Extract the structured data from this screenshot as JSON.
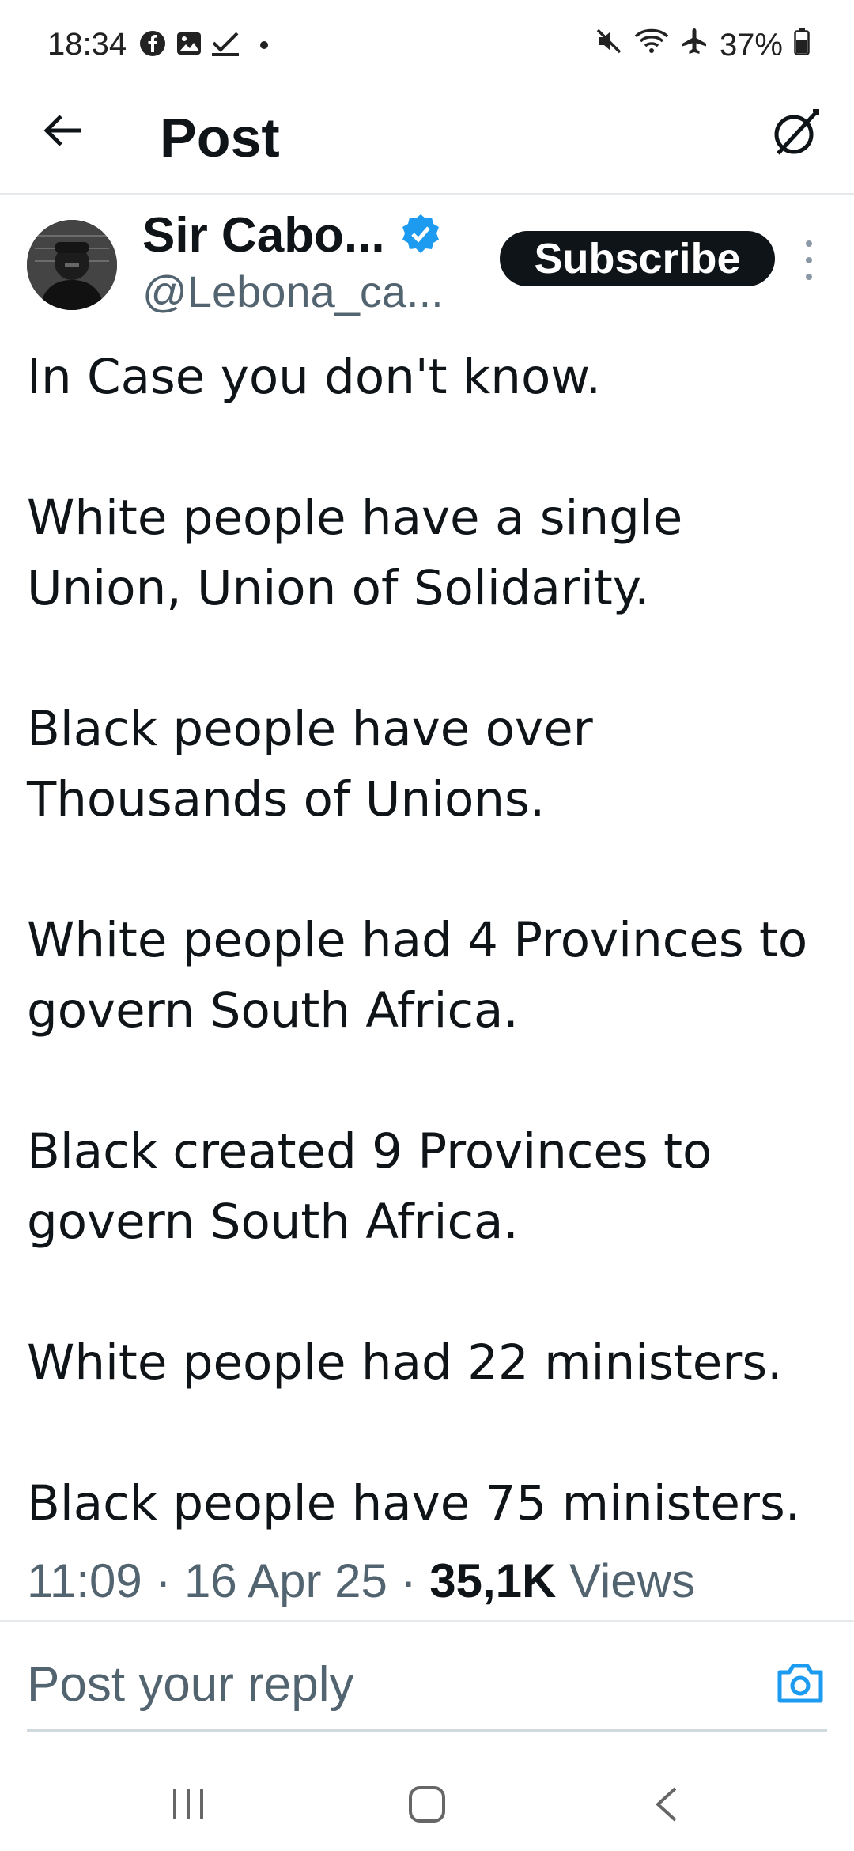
{
  "status_bar": {
    "time": "18:34",
    "battery": "37%",
    "left_icons": [
      "facebook-icon",
      "gallery-icon",
      "check-icon",
      "dot-icon"
    ],
    "right_icons": [
      "mute-icon",
      "wifi-icon",
      "airplane-icon",
      "battery-icon"
    ]
  },
  "header": {
    "title": "Post",
    "back_icon": "back-arrow-icon",
    "grok_icon": "grok-icon"
  },
  "author": {
    "name": "Sir Cabo...",
    "handle": "@Lebona_ca...",
    "verified": true,
    "subscribe_label": "Subscribe"
  },
  "post": {
    "paragraphs": [
      "In Case you don't know.",
      "White people have a single Union, Union of Solidarity.",
      "Black people have over Thousands of Unions.",
      "White people had 4 Provinces to govern South Africa.",
      "Black created 9 Provinces to govern South Africa.",
      "White people had 22 ministers.",
      "Black people have 75 ministers."
    ],
    "time": "11:09",
    "separator": "·",
    "date": "16 Apr 25",
    "views_count": "35,1K",
    "views_label": "Views"
  },
  "reply": {
    "placeholder": "Post your reply"
  },
  "colors": {
    "text": "#0f1419",
    "secondary": "#536471",
    "verified": "#1d9bf0",
    "button": "#0f1419"
  }
}
